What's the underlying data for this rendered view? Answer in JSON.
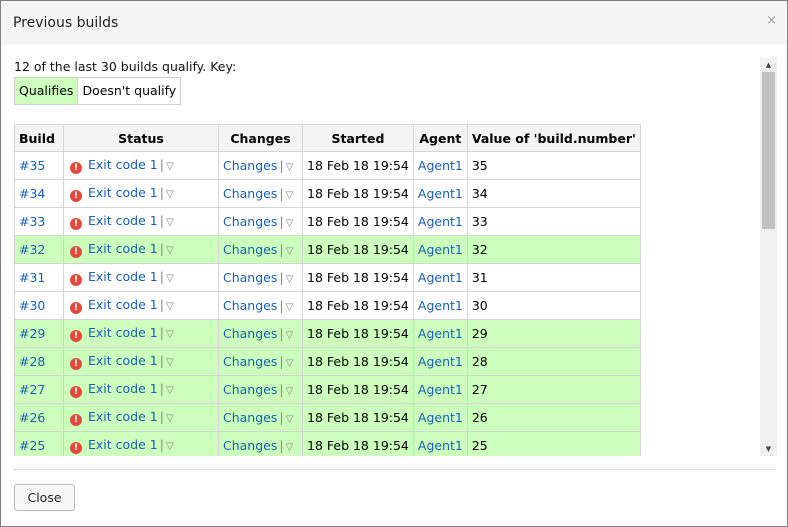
{
  "dialog": {
    "title": "Previous builds",
    "close_glyph": "×"
  },
  "summary": {
    "text": "12 of the last 30 builds qualify. Key:",
    "key_qualifies": "Qualifies",
    "key_not_qualify": "Doesn't qualify",
    "qualifies_color": "#ccffbb"
  },
  "table": {
    "headers": [
      "Build",
      "Status",
      "Changes",
      "Started",
      "Agent",
      "Value of 'build.number'"
    ],
    "rows": [
      {
        "build": "#35",
        "status": "Exit code 1",
        "changes": "Changes",
        "started": "18 Feb 18 19:54",
        "agent": "Agent1",
        "value": "35",
        "qualifies": false
      },
      {
        "build": "#34",
        "status": "Exit code 1",
        "changes": "Changes",
        "started": "18 Feb 18 19:54",
        "agent": "Agent1",
        "value": "34",
        "qualifies": false
      },
      {
        "build": "#33",
        "status": "Exit code 1",
        "changes": "Changes",
        "started": "18 Feb 18 19:54",
        "agent": "Agent1",
        "value": "33",
        "qualifies": false
      },
      {
        "build": "#32",
        "status": "Exit code 1",
        "changes": "Changes",
        "started": "18 Feb 18 19:54",
        "agent": "Agent1",
        "value": "32",
        "qualifies": true
      },
      {
        "build": "#31",
        "status": "Exit code 1",
        "changes": "Changes",
        "started": "18 Feb 18 19:54",
        "agent": "Agent1",
        "value": "31",
        "qualifies": false
      },
      {
        "build": "#30",
        "status": "Exit code 1",
        "changes": "Changes",
        "started": "18 Feb 18 19:54",
        "agent": "Agent1",
        "value": "30",
        "qualifies": false
      },
      {
        "build": "#29",
        "status": "Exit code 1",
        "changes": "Changes",
        "started": "18 Feb 18 19:54",
        "agent": "Agent1",
        "value": "29",
        "qualifies": true
      },
      {
        "build": "#28",
        "status": "Exit code 1",
        "changes": "Changes",
        "started": "18 Feb 18 19:54",
        "agent": "Agent1",
        "value": "28",
        "qualifies": true
      },
      {
        "build": "#27",
        "status": "Exit code 1",
        "changes": "Changes",
        "started": "18 Feb 18 19:54",
        "agent": "Agent1",
        "value": "27",
        "qualifies": true
      },
      {
        "build": "#26",
        "status": "Exit code 1",
        "changes": "Changes",
        "started": "18 Feb 18 19:54",
        "agent": "Agent1",
        "value": "26",
        "qualifies": true
      },
      {
        "build": "#25",
        "status": "Exit code 1",
        "changes": "Changes",
        "started": "18 Feb 18 19:54",
        "agent": "Agent1",
        "value": "25",
        "qualifies": true
      }
    ]
  },
  "icons": {
    "status": "error-icon",
    "dropdown": "triangle-down-icon"
  },
  "footer": {
    "close_label": "Close"
  }
}
